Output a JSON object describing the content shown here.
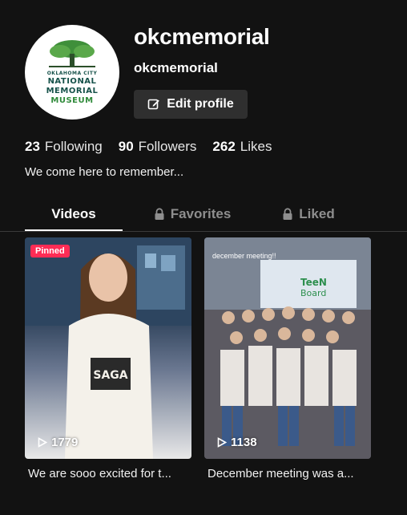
{
  "profile": {
    "display_name": "okcmemorial",
    "handle": "okcmemorial",
    "edit_label": "Edit profile",
    "bio": "We come here to remember...",
    "logo_lines": [
      "OKLAHOMA CITY",
      "NATIONAL",
      "MEMORIAL",
      "MUSEUM"
    ]
  },
  "stats": [
    {
      "count": "23",
      "label": "Following"
    },
    {
      "count": "90",
      "label": "Followers"
    },
    {
      "count": "262",
      "label": "Likes"
    }
  ],
  "tabs": [
    {
      "label": "Videos",
      "locked": false,
      "active": true
    },
    {
      "label": "Favorites",
      "locked": true,
      "active": false
    },
    {
      "label": "Liked",
      "locked": true,
      "active": false
    }
  ],
  "videos": [
    {
      "badge": "Pinned",
      "views": "1779",
      "caption": "We are sooo excited for t...",
      "overlay": ""
    },
    {
      "badge": "",
      "views": "1138",
      "caption": "December meeting was a...",
      "overlay": "december meeting!!"
    }
  ],
  "colors": {
    "background": "#121212",
    "pinned": "#fe2c55",
    "button": "#2f2f2f"
  }
}
